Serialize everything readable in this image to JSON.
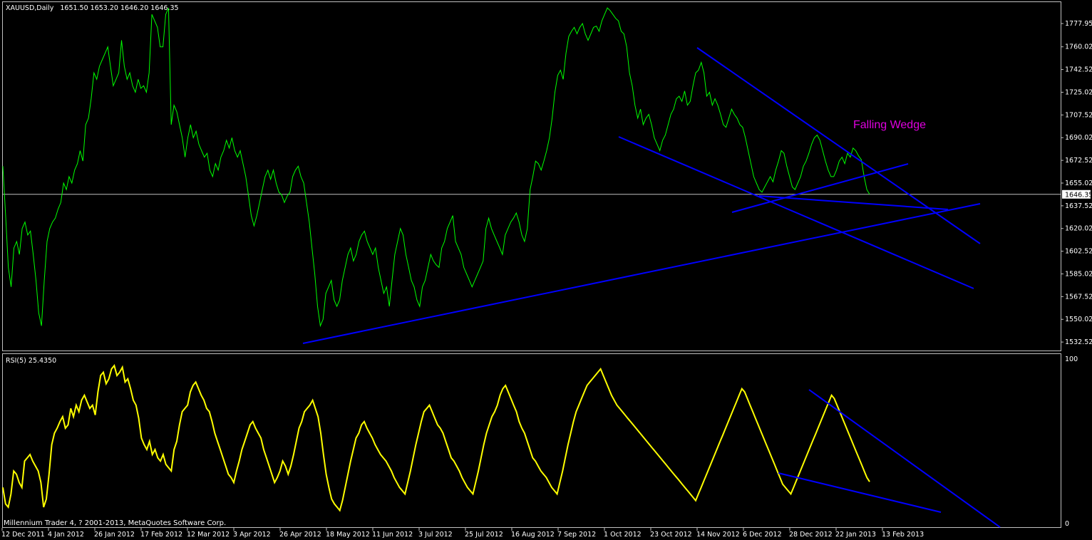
{
  "header": {
    "symbol_label": "XAUUSD,Daily",
    "ohlc_label": "1651.50 1653.20 1646.20 1646.35"
  },
  "rsi_header": {
    "label": "RSI(5) 25.4350"
  },
  "annotation": {
    "text": "Falling Wedge"
  },
  "footer": {
    "copyright": "Millennium Trader 4, ? 2001-2013, MetaQuotes Software Corp."
  },
  "colors": {
    "background": "#000000",
    "frame": "#c0c0c0",
    "price_line": "#00ff00",
    "rsi_line": "#ffff00",
    "trend_lines": "#0000ff",
    "annotation": "#e000e0",
    "current_price_line": "#c0c0c0"
  },
  "chart_data": [
    {
      "type": "line",
      "title": "XAUUSD,Daily",
      "ylim": [
        1526,
        1795
      ],
      "yticks": [
        "1777.95",
        "1760.02",
        "1742.52",
        "1725.02",
        "1707.52",
        "1690.02",
        "1672.52",
        "1655.02",
        "1637.52",
        "1620.02",
        "1602.52",
        "1585.02",
        "1567.52",
        "1550.02",
        "1532.52"
      ],
      "current_price": "1646.35",
      "x_ticks": [
        "12 Dec 2011",
        "4 Jan 2012",
        "26 Jan 2012",
        "17 Feb 2012",
        "12 Mar 2012",
        "3 Apr 2012",
        "26 Apr 2012",
        "18 May 2012",
        "11 Jun 2012",
        "3 Jul 2012",
        "25 Jul 2012",
        "16 Aug 2012",
        "7 Sep 2012",
        "1 Oct 2012",
        "23 Oct 2012",
        "14 Nov 2012",
        "6 Dec 2012",
        "28 Dec 2012",
        "22 Jan 2013",
        "13 Feb 2013"
      ],
      "series": [
        {
          "values": [
            1668,
            1630,
            1590,
            1575,
            1605,
            1610,
            1600,
            1620,
            1625,
            1615,
            1618,
            1600,
            1580,
            1555,
            1545,
            1580,
            1610,
            1620,
            1625,
            1628,
            1635,
            1640,
            1655,
            1650,
            1660,
            1655,
            1665,
            1670,
            1680,
            1672,
            1700,
            1705,
            1720,
            1740,
            1735,
            1745,
            1750,
            1755,
            1760,
            1745,
            1730,
            1735,
            1740,
            1765,
            1745,
            1735,
            1740,
            1730,
            1725,
            1735,
            1728,
            1730,
            1725,
            1740,
            1785,
            1780,
            1775,
            1760,
            1760,
            1785,
            1790,
            1700,
            1715,
            1710,
            1700,
            1690,
            1675,
            1690,
            1700,
            1690,
            1695,
            1685,
            1680,
            1675,
            1678,
            1665,
            1660,
            1670,
            1665,
            1675,
            1680,
            1688,
            1682,
            1690,
            1680,
            1675,
            1680,
            1670,
            1660,
            1645,
            1630,
            1622,
            1630,
            1640,
            1650,
            1660,
            1665,
            1658,
            1665,
            1655,
            1648,
            1646,
            1640,
            1645,
            1648,
            1660,
            1665,
            1668,
            1660,
            1655,
            1640,
            1625,
            1605,
            1585,
            1560,
            1545,
            1550,
            1570,
            1575,
            1580,
            1565,
            1560,
            1565,
            1580,
            1590,
            1600,
            1605,
            1595,
            1600,
            1610,
            1615,
            1618,
            1610,
            1605,
            1600,
            1605,
            1590,
            1580,
            1570,
            1575,
            1560,
            1580,
            1600,
            1610,
            1620,
            1615,
            1600,
            1590,
            1580,
            1575,
            1565,
            1560,
            1575,
            1580,
            1590,
            1600,
            1595,
            1592,
            1590,
            1605,
            1610,
            1620,
            1625,
            1630,
            1610,
            1605,
            1600,
            1590,
            1585,
            1580,
            1575,
            1580,
            1585,
            1590,
            1595,
            1620,
            1628,
            1620,
            1615,
            1610,
            1605,
            1600,
            1615,
            1620,
            1625,
            1628,
            1632,
            1625,
            1615,
            1610,
            1620,
            1650,
            1660,
            1672,
            1670,
            1665,
            1672,
            1680,
            1690,
            1705,
            1725,
            1738,
            1742,
            1735,
            1755,
            1768,
            1772,
            1775,
            1770,
            1775,
            1778,
            1770,
            1765,
            1770,
            1775,
            1776,
            1772,
            1780,
            1785,
            1790,
            1788,
            1785,
            1782,
            1780,
            1772,
            1770,
            1760,
            1740,
            1730,
            1715,
            1705,
            1712,
            1700,
            1705,
            1708,
            1700,
            1690,
            1685,
            1680,
            1688,
            1692,
            1700,
            1708,
            1712,
            1720,
            1722,
            1718,
            1726,
            1715,
            1718,
            1730,
            1740,
            1742,
            1748,
            1740,
            1722,
            1725,
            1715,
            1720,
            1715,
            1708,
            1700,
            1698,
            1705,
            1712,
            1708,
            1705,
            1700,
            1698,
            1690,
            1680,
            1670,
            1660,
            1655,
            1650,
            1648,
            1652,
            1656,
            1660,
            1656,
            1665,
            1672,
            1680,
            1678,
            1668,
            1660,
            1652,
            1650,
            1655,
            1660,
            1668,
            1672,
            1678,
            1685,
            1690,
            1692,
            1688,
            1680,
            1672,
            1665,
            1660,
            1660,
            1665,
            1672,
            1675,
            1670,
            1678,
            1675,
            1682,
            1680,
            1676,
            1673,
            1660,
            1650,
            1646.35
          ]
        }
      ],
      "annotations": [
        "Falling Wedge"
      ]
    },
    {
      "type": "line",
      "title": "RSI(5) 25.4350",
      "ylim": [
        0,
        100
      ],
      "yticks": [
        "100",
        "0"
      ],
      "series": [
        {
          "values": [
            22,
            12,
            10,
            18,
            32,
            30,
            25,
            22,
            38,
            40,
            42,
            38,
            35,
            32,
            25,
            10,
            15,
            30,
            48,
            55,
            58,
            62,
            65,
            58,
            60,
            70,
            65,
            72,
            68,
            75,
            78,
            74,
            70,
            72,
            66,
            80,
            90,
            92,
            85,
            88,
            94,
            96,
            90,
            92,
            95,
            86,
            88,
            82,
            75,
            72,
            64,
            52,
            48,
            45,
            50,
            42,
            45,
            40,
            38,
            42,
            36,
            34,
            32,
            45,
            50,
            60,
            68,
            70,
            72,
            80,
            84,
            86,
            82,
            78,
            75,
            70,
            68,
            62,
            55,
            50,
            45,
            40,
            35,
            30,
            28,
            25,
            32,
            38,
            45,
            50,
            55,
            60,
            62,
            58,
            55,
            52,
            45,
            40,
            35,
            30,
            25,
            28,
            32,
            38,
            35,
            30,
            35,
            42,
            50,
            58,
            62,
            68,
            70,
            72,
            75,
            70,
            65,
            55,
            42,
            30,
            22,
            15,
            12,
            10,
            8,
            14,
            22,
            30,
            38,
            45,
            52,
            55,
            60,
            62,
            58,
            55,
            52,
            48,
            45,
            42,
            40,
            38,
            35,
            32,
            28,
            25,
            22,
            20,
            18,
            25,
            32,
            40,
            48,
            55,
            62,
            68,
            70,
            72,
            68,
            64,
            60,
            58,
            55,
            50,
            45,
            40,
            38,
            35,
            32,
            28,
            25,
            22,
            20,
            18,
            25,
            32,
            40,
            48,
            55,
            60,
            65,
            68,
            72,
            78,
            82,
            84,
            80,
            76,
            72,
            68,
            62,
            58,
            55,
            50,
            45,
            40,
            38,
            35,
            32,
            30,
            28,
            25,
            22,
            20,
            18,
            25,
            32,
            40,
            48,
            55,
            62,
            68,
            72,
            76,
            80,
            84,
            86,
            88,
            90,
            92,
            94,
            90,
            86,
            82,
            78,
            75,
            72,
            70,
            68,
            66,
            64,
            62,
            60,
            58,
            56,
            54,
            52,
            50,
            48,
            46,
            44,
            42,
            40,
            38,
            36,
            34,
            32,
            30,
            28,
            26,
            24,
            22,
            20,
            18,
            16,
            14,
            18,
            22,
            26,
            30,
            34,
            38,
            42,
            46,
            50,
            54,
            58,
            62,
            66,
            70,
            74,
            78,
            82,
            80,
            76,
            72,
            68,
            64,
            60,
            56,
            52,
            48,
            44,
            40,
            36,
            32,
            28,
            24,
            22,
            20,
            18,
            22,
            26,
            30,
            34,
            38,
            42,
            46,
            50,
            54,
            58,
            62,
            66,
            70,
            74,
            78,
            76,
            72,
            68,
            64,
            60,
            56,
            52,
            48,
            44,
            40,
            36,
            32,
            28,
            25.435
          ]
        }
      ]
    }
  ]
}
